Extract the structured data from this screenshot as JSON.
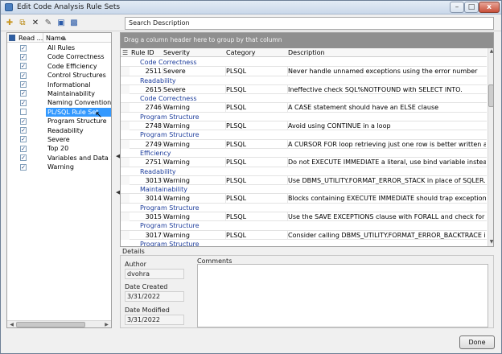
{
  "window": {
    "title": "Edit Code Analysis Rule Sets"
  },
  "titlebar_buttons": {
    "minimize": "–",
    "maximize": "□",
    "close": "x"
  },
  "toolbar": {
    "icons": [
      "new-icon",
      "copy-icon",
      "delete-icon",
      "edit-icon",
      "save-icon",
      "save-as-icon"
    ]
  },
  "search": {
    "placeholder": "Search Description"
  },
  "left_panel": {
    "header": {
      "read_label": "Read ...",
      "name_label": "Name",
      "sort_arrow": "▲"
    },
    "items": [
      {
        "checked": true,
        "name": "All Rules"
      },
      {
        "checked": true,
        "name": "Code Correctness"
      },
      {
        "checked": true,
        "name": "Code Efficiency"
      },
      {
        "checked": true,
        "name": "Control Structures"
      },
      {
        "checked": true,
        "name": "Informational"
      },
      {
        "checked": true,
        "name": "Maintainability"
      },
      {
        "checked": true,
        "name": "Naming Conventions"
      },
      {
        "checked": false,
        "name": "PL/SQL Rule Set",
        "selected": true
      },
      {
        "checked": true,
        "name": "Program Structure"
      },
      {
        "checked": true,
        "name": "Readability"
      },
      {
        "checked": true,
        "name": "Severe"
      },
      {
        "checked": true,
        "name": "Top 20"
      },
      {
        "checked": true,
        "name": "Variables and Data Structures"
      },
      {
        "checked": true,
        "name": "Warning"
      }
    ],
    "check_mark": "✓"
  },
  "grid": {
    "group_hint": "Drag a column header here to group by that column",
    "columns": {
      "rule_id": "Rule ID",
      "severity": "Severity",
      "category": "Category",
      "description": "Description"
    },
    "rows": [
      {
        "type": "group",
        "label": "Code Correctness"
      },
      {
        "type": "data",
        "rule_id": "2511",
        "severity": "Severe",
        "category": "PLSQL",
        "description": "Never handle unnamed exceptions using the error number"
      },
      {
        "type": "group",
        "label": "Readability"
      },
      {
        "type": "data",
        "rule_id": "2615",
        "severity": "Severe",
        "category": "PLSQL",
        "description": "Ineffective check SQL%NOTFOUND with SELECT INTO."
      },
      {
        "type": "group",
        "label": "Code Correctness"
      },
      {
        "type": "data",
        "rule_id": "2746",
        "severity": "Warning",
        "category": "PLSQL",
        "description": "A CASE statement should have an ELSE clause"
      },
      {
        "type": "group",
        "label": "Program Structure"
      },
      {
        "type": "data",
        "rule_id": "2748",
        "severity": "Warning",
        "category": "PLSQL",
        "description": "Avoid using CONTINUE in a loop"
      },
      {
        "type": "group",
        "label": "Program Structure"
      },
      {
        "type": "data",
        "rule_id": "2749",
        "severity": "Warning",
        "category": "PLSQL",
        "description": "A CURSOR FOR loop retrieving just one row is better written as..."
      },
      {
        "type": "group",
        "label": "Efficiency"
      },
      {
        "type": "data",
        "rule_id": "2751",
        "severity": "Warning",
        "category": "PLSQL",
        "description": "Do not EXECUTE IMMEDIATE a literal, use bind variable instead"
      },
      {
        "type": "group",
        "label": "Readability"
      },
      {
        "type": "data",
        "rule_id": "3013",
        "severity": "Warning",
        "category": "PLSQL",
        "description": "Use DBMS_UTILITY.FORMAT_ERROR_STACK in place of SQLER..."
      },
      {
        "type": "group",
        "label": "Maintainability"
      },
      {
        "type": "data",
        "rule_id": "3014",
        "severity": "Warning",
        "category": "PLSQL",
        "description": "Blocks containing EXECUTE IMMEDIATE should trap exceptions."
      },
      {
        "type": "group",
        "label": "Program Structure"
      },
      {
        "type": "data",
        "rule_id": "3015",
        "severity": "Warning",
        "category": "PLSQL",
        "description": "Use the SAVE EXCEPTIONS clause with FORALL and check for e..."
      },
      {
        "type": "group",
        "label": "Program Structure"
      },
      {
        "type": "data",
        "rule_id": "3017",
        "severity": "Warning",
        "category": "PLSQL",
        "description": "Consider calling DBMS_UTILITY.FORMAT_ERROR_BACKTRACE i..."
      },
      {
        "type": "group",
        "label": "Program Structure"
      }
    ]
  },
  "details": {
    "section_label": "Details",
    "author_label": "Author",
    "author": "dvohra",
    "date_created_label": "Date Created",
    "date_created": "3/31/2022",
    "date_modified_label": "Date Modified",
    "date_modified": "3/31/2022",
    "comments_label": "Comments",
    "comments": ""
  },
  "done_button": {
    "label": "Done"
  },
  "colors": {
    "group_text": "#1d3d9c",
    "selection": "#3399ff",
    "group_area": "#8f8f8f"
  }
}
